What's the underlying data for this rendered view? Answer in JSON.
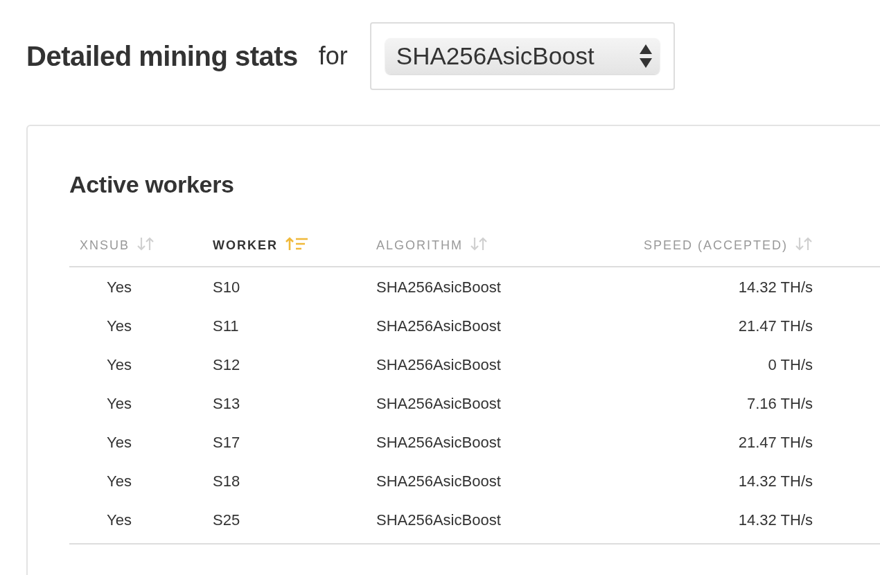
{
  "heading": "Detailed mining stats",
  "connector": "for",
  "algorithm_select": {
    "value": "SHA256AsicBoost"
  },
  "card": {
    "title": "Active workers",
    "table": {
      "columns": [
        {
          "label": "XNSUB",
          "sorted": false
        },
        {
          "label": "WORKER",
          "sorted": true
        },
        {
          "label": "ALGORITHM",
          "sorted": false
        },
        {
          "label": "SPEED (ACCEPTED)",
          "sorted": false
        }
      ],
      "rows": [
        [
          "Yes",
          "S10",
          "SHA256AsicBoost",
          "14.32 TH/s"
        ],
        [
          "Yes",
          "S11",
          "SHA256AsicBoost",
          "21.47 TH/s"
        ],
        [
          "Yes",
          "S12",
          "SHA256AsicBoost",
          "0 TH/s"
        ],
        [
          "Yes",
          "S13",
          "SHA256AsicBoost",
          "7.16 TH/s"
        ],
        [
          "Yes",
          "S17",
          "SHA256AsicBoost",
          "21.47 TH/s"
        ],
        [
          "Yes",
          "S18",
          "SHA256AsicBoost",
          "14.32 TH/s"
        ],
        [
          "Yes",
          "S25",
          "SHA256AsicBoost",
          "14.32 TH/s"
        ]
      ]
    }
  }
}
